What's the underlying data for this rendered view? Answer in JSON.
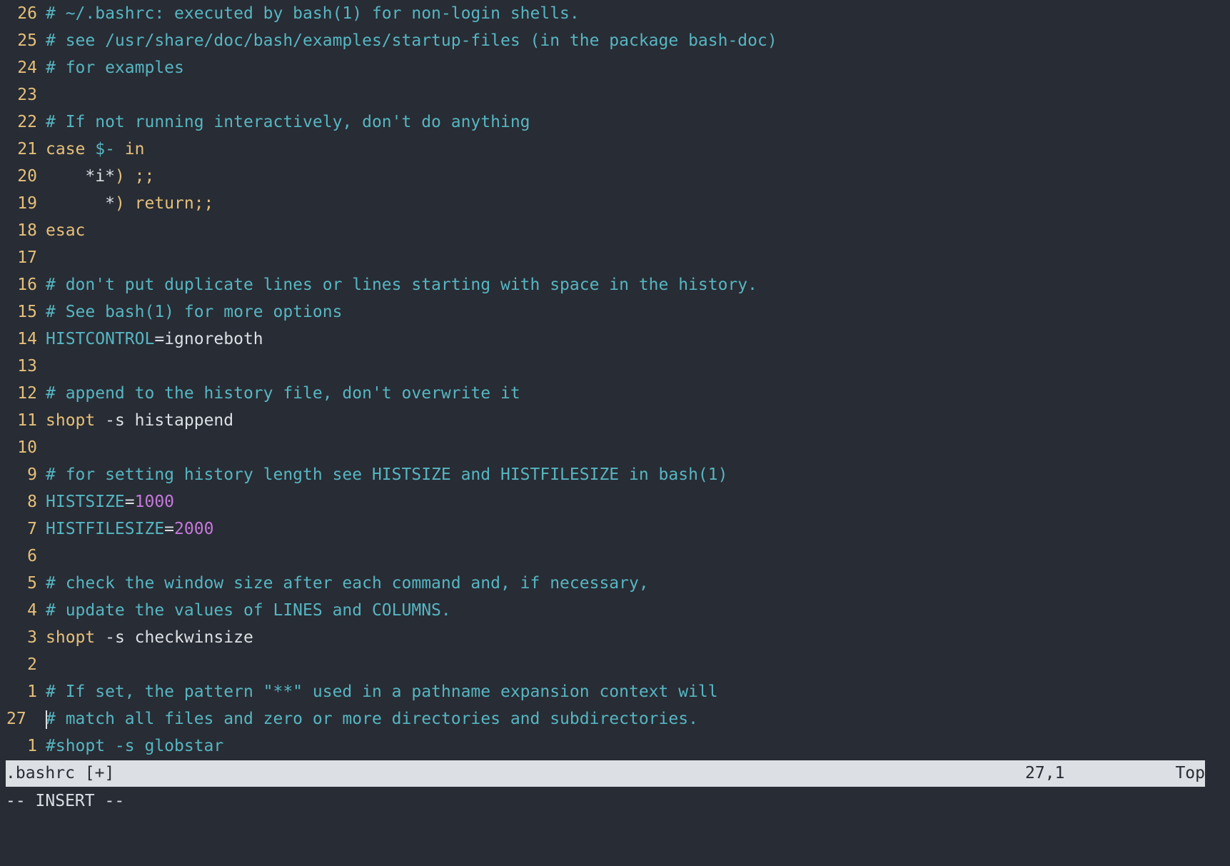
{
  "editor": {
    "lines": [
      {
        "n": "26",
        "parts": [
          {
            "t": "c",
            "s": "# ~/.bashrc: executed by bash(1) for non-login shells."
          }
        ]
      },
      {
        "n": "25",
        "parts": [
          {
            "t": "c",
            "s": "# see /usr/share/doc/bash/examples/startup-files (in the package bash-doc)"
          }
        ]
      },
      {
        "n": "24",
        "parts": [
          {
            "t": "c",
            "s": "# for examples"
          }
        ]
      },
      {
        "n": "23",
        "parts": []
      },
      {
        "n": "22",
        "parts": [
          {
            "t": "c",
            "s": "# If not running interactively, don't do anything"
          }
        ]
      },
      {
        "n": "21",
        "parts": [
          {
            "t": "k",
            "s": "case "
          },
          {
            "t": "v",
            "s": "$-"
          },
          {
            "t": "k",
            "s": " in"
          }
        ]
      },
      {
        "n": "20",
        "parts": [
          {
            "t": "p",
            "s": "    *i*"
          },
          {
            "t": "k",
            "s": ") ;;"
          }
        ]
      },
      {
        "n": "19",
        "parts": [
          {
            "t": "p",
            "s": "      *"
          },
          {
            "t": "k",
            "s": ") return;;"
          }
        ]
      },
      {
        "n": "18",
        "parts": [
          {
            "t": "k",
            "s": "esac"
          }
        ]
      },
      {
        "n": "17",
        "parts": []
      },
      {
        "n": "16",
        "parts": [
          {
            "t": "c",
            "s": "# don't put duplicate lines or lines starting with space in the history."
          }
        ]
      },
      {
        "n": "15",
        "parts": [
          {
            "t": "c",
            "s": "# See bash(1) for more options"
          }
        ]
      },
      {
        "n": "14",
        "parts": [
          {
            "t": "v",
            "s": "HISTCONTROL"
          },
          {
            "t": "p",
            "s": "=ignoreboth"
          }
        ]
      },
      {
        "n": "13",
        "parts": []
      },
      {
        "n": "12",
        "parts": [
          {
            "t": "c",
            "s": "# append to the history file, don't overwrite it"
          }
        ]
      },
      {
        "n": "11",
        "parts": [
          {
            "t": "k",
            "s": "shopt"
          },
          {
            "t": "p",
            "s": " -s histappend"
          }
        ]
      },
      {
        "n": "10",
        "parts": []
      },
      {
        "n": "9",
        "parts": [
          {
            "t": "c",
            "s": "# for setting history length see HISTSIZE and HISTFILESIZE in bash(1)"
          }
        ]
      },
      {
        "n": "8",
        "parts": [
          {
            "t": "v",
            "s": "HISTSIZE"
          },
          {
            "t": "p",
            "s": "="
          },
          {
            "t": "n",
            "s": "1000"
          }
        ]
      },
      {
        "n": "7",
        "parts": [
          {
            "t": "v",
            "s": "HISTFILESIZE"
          },
          {
            "t": "p",
            "s": "="
          },
          {
            "t": "n",
            "s": "2000"
          }
        ]
      },
      {
        "n": "6",
        "parts": []
      },
      {
        "n": "5",
        "parts": [
          {
            "t": "c",
            "s": "# check the window size after each command and, if necessary,"
          }
        ]
      },
      {
        "n": "4",
        "parts": [
          {
            "t": "c",
            "s": "# update the values of LINES and COLUMNS."
          }
        ]
      },
      {
        "n": "3",
        "parts": [
          {
            "t": "k",
            "s": "shopt"
          },
          {
            "t": "p",
            "s": " -s checkwinsize"
          }
        ]
      },
      {
        "n": "2",
        "parts": []
      },
      {
        "n": "1",
        "parts": [
          {
            "t": "c",
            "s": "# If set, the pattern \"**\" used in a pathname expansion context will"
          }
        ]
      },
      {
        "n": "27",
        "current": true,
        "parts": [
          {
            "t": "c",
            "s": "# match all files and zero or more directories and subdirectories."
          }
        ]
      },
      {
        "n": "1",
        "parts": [
          {
            "t": "c",
            "s": "#shopt -s globstar"
          }
        ]
      }
    ]
  },
  "statusbar": {
    "filename": ".bashrc [+]",
    "position": "27,1",
    "scroll": "Top"
  },
  "mode": "-- INSERT --",
  "colors": {
    "background": "#282c34",
    "comment": "#56b6c2",
    "keyword": "#e5c07b",
    "number": "#c678dd",
    "statusbar": "#dcdfe4"
  }
}
